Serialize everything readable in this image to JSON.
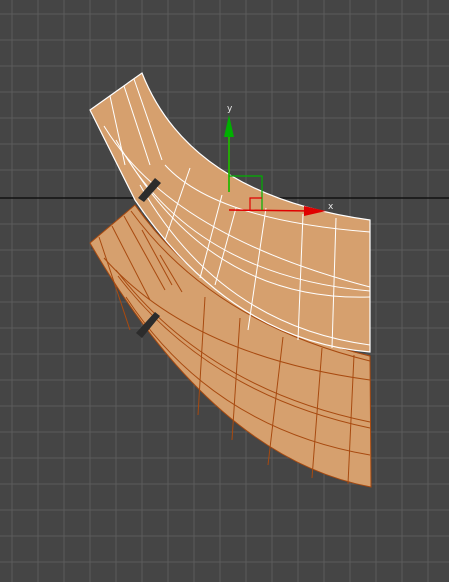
{
  "viewport": {
    "background": "#454545",
    "grid_color": "#5a5a5a",
    "horizon_color": "#111111"
  },
  "mesh": {
    "fill": "#d6a06e",
    "unselected_wire_color": "#a84a10",
    "selected_wire_color": "#ffffff"
  },
  "gizmo": {
    "x_label": "x",
    "y_label": "y",
    "x_color": "#e00000",
    "y_color": "#00b000",
    "z_color": "#e8e000"
  }
}
